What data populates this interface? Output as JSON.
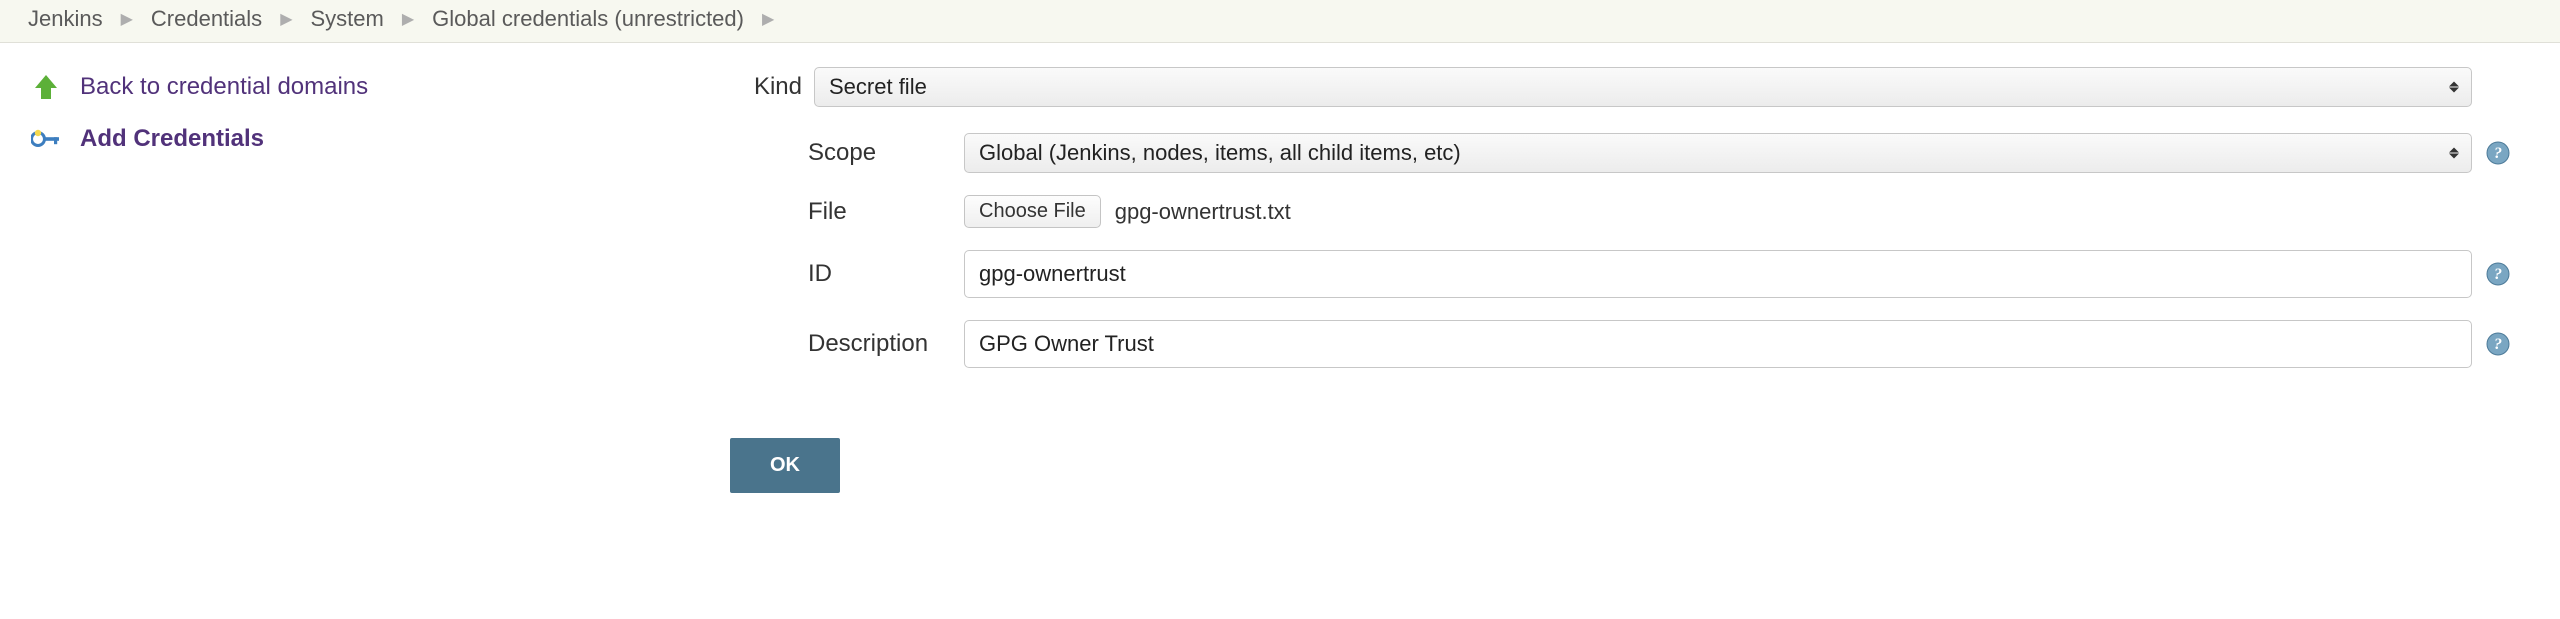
{
  "breadcrumbs": [
    {
      "label": "Jenkins"
    },
    {
      "label": "Credentials"
    },
    {
      "label": "System"
    },
    {
      "label": "Global credentials (unrestricted)"
    }
  ],
  "sidebar": {
    "back_label": "Back to credential domains",
    "add_label": "Add Credentials"
  },
  "form": {
    "kind_label": "Kind",
    "kind_value": "Secret file",
    "scope_label": "Scope",
    "scope_value": "Global (Jenkins, nodes, items, all child items, etc)",
    "file_label": "File",
    "file_button": "Choose File",
    "file_name": "gpg-ownertrust.txt",
    "id_label": "ID",
    "id_value": "gpg-ownertrust",
    "description_label": "Description",
    "description_value": "GPG Owner Trust",
    "ok_label": "OK"
  }
}
